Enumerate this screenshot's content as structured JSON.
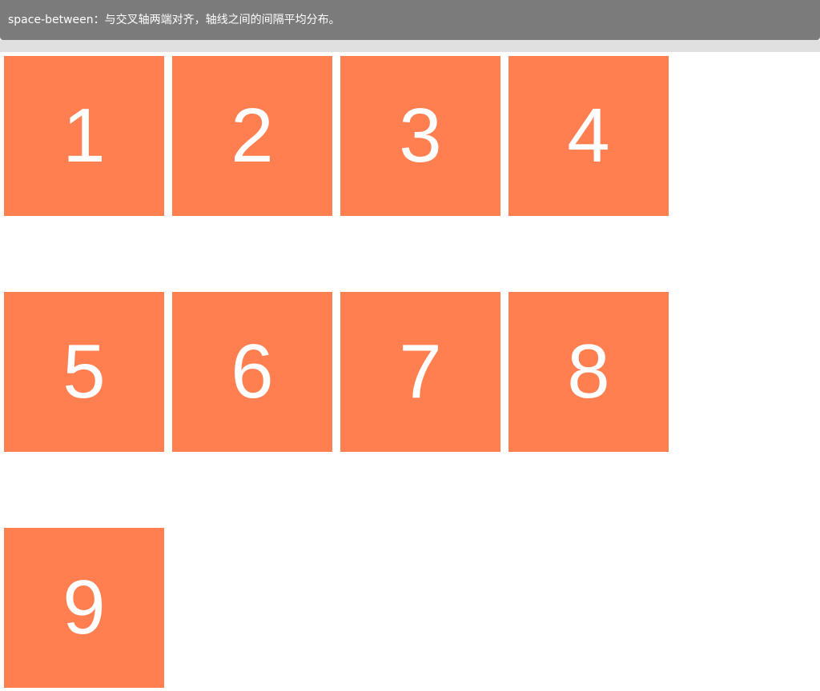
{
  "header": {
    "text": "space-between：与交叉轴两端对齐，轴线之间的间隔平均分布。"
  },
  "items": [
    "1",
    "2",
    "3",
    "4",
    "5",
    "6",
    "7",
    "8",
    "9"
  ],
  "colors": {
    "item": "#ff7f50",
    "header": "#7b7b7b"
  }
}
